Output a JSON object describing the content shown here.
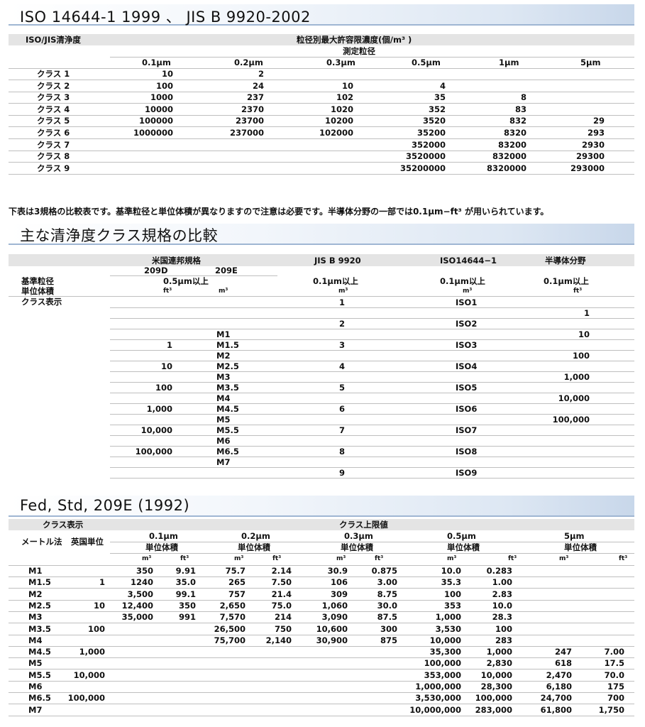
{
  "section1": {
    "title": "ISO 14644-1 1999 、 JIS B 9920-2002",
    "col_header_class": "ISO/JIS清浄度",
    "col_header_conc": "粒径別最大許容限濃度(個/m³ )",
    "sub_header": "測定粒径",
    "sizes": [
      "0.1μm",
      "0.2μm",
      "0.3μm",
      "0.5μm",
      "1μm",
      "5μm"
    ],
    "rows": [
      {
        "label": "クラス 1",
        "v": [
          "10",
          "2",
          "",
          "",
          "",
          ""
        ]
      },
      {
        "label": "クラス 2",
        "v": [
          "100",
          "24",
          "10",
          "4",
          "",
          ""
        ]
      },
      {
        "label": "クラス 3",
        "v": [
          "1000",
          "237",
          "102",
          "35",
          "8",
          ""
        ]
      },
      {
        "label": "クラス 4",
        "v": [
          "10000",
          "2370",
          "1020",
          "352",
          "83",
          ""
        ]
      },
      {
        "label": "クラス 5",
        "v": [
          "100000",
          "23700",
          "10200",
          "3520",
          "832",
          "29"
        ]
      },
      {
        "label": "クラス 6",
        "v": [
          "1000000",
          "237000",
          "102000",
          "35200",
          "8320",
          "293"
        ]
      },
      {
        "label": "クラス 7",
        "v": [
          "",
          "",
          "",
          "352000",
          "83200",
          "2930"
        ]
      },
      {
        "label": "クラス 8",
        "v": [
          "",
          "",
          "",
          "3520000",
          "832000",
          "29300"
        ]
      },
      {
        "label": "クラス 9",
        "v": [
          "",
          "",
          "",
          "35200000",
          "8320000",
          "293000"
        ]
      }
    ]
  },
  "note": "下表は3規格の比較表です。基準粒径と単位体積が異なりますので注意は必要です。半導体分野の一部では0.1μm−ft³ が用いられています。",
  "section2": {
    "title": "主な清浄度クラス規格の比較",
    "h_fed": "米国連邦規格",
    "h_jis": "JIS B 9920",
    "h_iso": "ISO14644−1",
    "h_semi": "半導体分野",
    "h_209d": "209D",
    "h_209e": "209E",
    "row_label_size": "基準粒径",
    "row_label_unit": "単位体積",
    "row_label_class": "クラス表示",
    "fed_size": "0.5μm以上",
    "jis_size": "0.1μm以上",
    "iso_size": "0.1μm以上",
    "semi_size": "0.1μm以上",
    "u_209d": "ft³",
    "u_209e": "m³",
    "u_jis": "m³",
    "u_iso": "m³",
    "u_semi": "ft³",
    "rows": [
      {
        "d": "",
        "e": "",
        "jis": "1",
        "iso": "ISO1",
        "semi": ""
      },
      {
        "d": "",
        "e": "",
        "jis": "",
        "iso": "",
        "semi": "1"
      },
      {
        "d": "",
        "e": "",
        "jis": "2",
        "iso": "ISO2",
        "semi": ""
      },
      {
        "d": "",
        "e": "M1",
        "jis": "",
        "iso": "",
        "semi": "10"
      },
      {
        "d": "1",
        "e": "M1.5",
        "jis": "3",
        "iso": "ISO3",
        "semi": ""
      },
      {
        "d": "",
        "e": "M2",
        "jis": "",
        "iso": "",
        "semi": "100"
      },
      {
        "d": "10",
        "e": "M2.5",
        "jis": "4",
        "iso": "ISO4",
        "semi": ""
      },
      {
        "d": "",
        "e": "M3",
        "jis": "",
        "iso": "",
        "semi": "1,000"
      },
      {
        "d": "100",
        "e": "M3.5",
        "jis": "5",
        "iso": "ISO5",
        "semi": ""
      },
      {
        "d": "",
        "e": "M4",
        "jis": "",
        "iso": "",
        "semi": "10,000"
      },
      {
        "d": "1,000",
        "e": "M4.5",
        "jis": "6",
        "iso": "ISO6",
        "semi": ""
      },
      {
        "d": "",
        "e": "M5",
        "jis": "",
        "iso": "",
        "semi": "100,000"
      },
      {
        "d": "10,000",
        "e": "M5.5",
        "jis": "7",
        "iso": "ISO7",
        "semi": ""
      },
      {
        "d": "",
        "e": "M6",
        "jis": "",
        "iso": "",
        "semi": ""
      },
      {
        "d": "100,000",
        "e": "M6.5",
        "jis": "8",
        "iso": "ISO8",
        "semi": ""
      },
      {
        "d": "",
        "e": "M7",
        "jis": "",
        "iso": "",
        "semi": ""
      },
      {
        "d": "",
        "e": "",
        "jis": "9",
        "iso": "ISO9",
        "semi": ""
      }
    ]
  },
  "section3": {
    "title": "Fed, Std, 209E (1992)",
    "h_class": "クラス表示",
    "h_limit": "クラス上限値",
    "h_metric": "メートル法",
    "h_english": "英国単位",
    "sizes": [
      "0.1μm",
      "0.2μm",
      "0.3μm",
      "0.5μm",
      "5μm"
    ],
    "unit_vol": "単位体積",
    "u_m3": "m³",
    "u_ft3": "ft³",
    "rows": [
      {
        "m": "M1",
        "e": "",
        "v": [
          "350",
          "9.91",
          "75.7",
          "2.14",
          "30.9",
          "0.875",
          "10.0",
          "0.283",
          "",
          ""
        ]
      },
      {
        "m": "M1.5",
        "e": "1",
        "v": [
          "1240",
          "35.0",
          "265",
          "7.50",
          "106",
          "3.00",
          "35.3",
          "1.00",
          "",
          ""
        ]
      },
      {
        "m": "M2",
        "e": "",
        "v": [
          "3,500",
          "99.1",
          "757",
          "21.4",
          "309",
          "8.75",
          "100",
          "2.83",
          "",
          ""
        ]
      },
      {
        "m": "M2.5",
        "e": "10",
        "v": [
          "12,400",
          "350",
          "2,650",
          "75.0",
          "1,060",
          "30.0",
          "353",
          "10.0",
          "",
          ""
        ]
      },
      {
        "m": "M3",
        "e": "",
        "v": [
          "35,000",
          "991",
          "7,570",
          "214",
          "3,090",
          "87.5",
          "1,000",
          "28.3",
          "",
          ""
        ]
      },
      {
        "m": "M3.5",
        "e": "100",
        "v": [
          "",
          "",
          "26,500",
          "750",
          "10,600",
          "300",
          "3,530",
          "100",
          "",
          ""
        ]
      },
      {
        "m": "M4",
        "e": "",
        "v": [
          "",
          "",
          "75,700",
          "2,140",
          "30,900",
          "875",
          "10,000",
          "283",
          "",
          ""
        ]
      },
      {
        "m": "M4.5",
        "e": "1,000",
        "v": [
          "",
          "",
          "",
          "",
          "",
          "",
          "35,300",
          "1,000",
          "247",
          "7.00"
        ]
      },
      {
        "m": "M5",
        "e": "",
        "v": [
          "",
          "",
          "",
          "",
          "",
          "",
          "100,000",
          "2,830",
          "618",
          "17.5"
        ]
      },
      {
        "m": "M5.5",
        "e": "10,000",
        "v": [
          "",
          "",
          "",
          "",
          "",
          "",
          "353,000",
          "10,000",
          "2,470",
          "70.0"
        ]
      },
      {
        "m": "M6",
        "e": "",
        "v": [
          "",
          "",
          "",
          "",
          "",
          "",
          "1,000,000",
          "28,300",
          "6,180",
          "175"
        ]
      },
      {
        "m": "M6.5",
        "e": "100,000",
        "v": [
          "",
          "",
          "",
          "",
          "",
          "",
          "3,530,000",
          "100,000",
          "24,700",
          "700"
        ]
      },
      {
        "m": "M7",
        "e": "",
        "v": [
          "",
          "",
          "",
          "",
          "",
          "",
          "10,000,000",
          "283,000",
          "61,800",
          "1,750"
        ]
      }
    ]
  }
}
